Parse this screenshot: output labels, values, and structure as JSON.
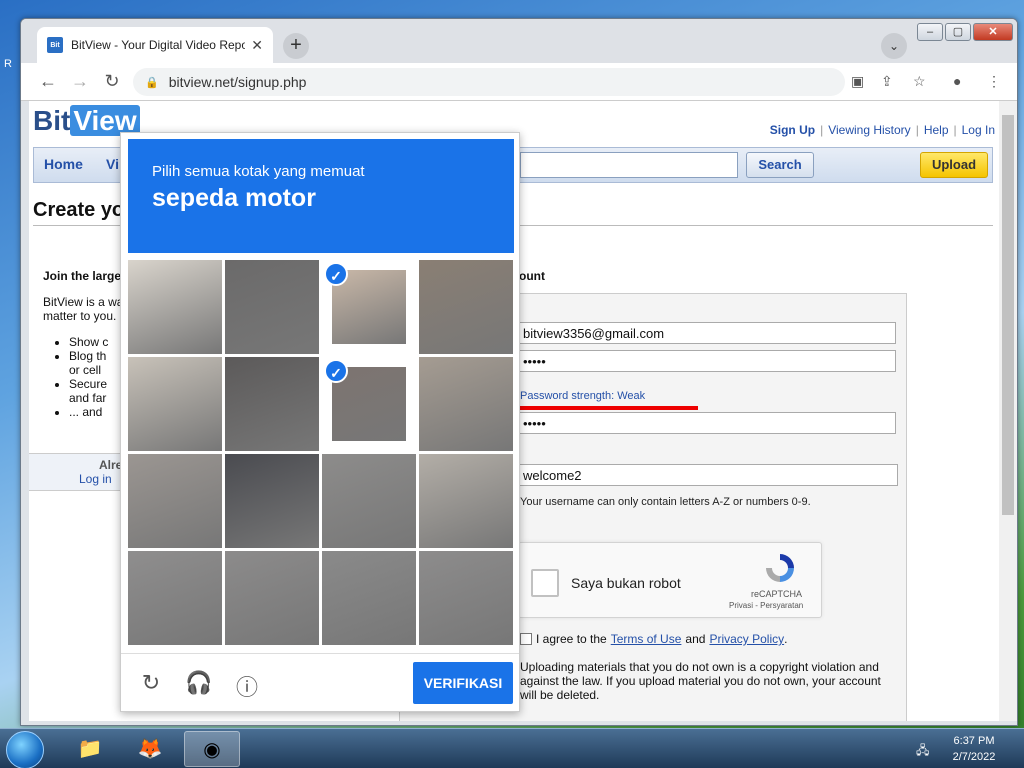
{
  "desktop": {
    "corner_text": "R"
  },
  "browser": {
    "tab_favicon": "Bit",
    "tab_title": "BitView - Your Digital Video Repo",
    "url": "bitview.net/signup.php",
    "icons": [
      "back-icon",
      "forward-icon",
      "reload-icon",
      "lock-icon",
      "cast-icon",
      "share-icon",
      "star-icon",
      "profile-icon",
      "menu-icon"
    ]
  },
  "site": {
    "logo_a": "Bit",
    "logo_b": "View",
    "links": [
      "Sign Up",
      "Viewing History",
      "Help",
      "Log In"
    ],
    "nav_home": "Home",
    "nav_vi": "Vi",
    "search_label": "Search",
    "upload_label": "Upload",
    "page_heading": "Create yo",
    "join_heading": "Join the large",
    "intro_line1": "BitView is a wa",
    "intro_line2": "matter to you.",
    "bullets": [
      "Show c",
      "Blog th",
      "or cell",
      "Secure",
      "and far",
      "... and"
    ],
    "already_label": "Alrea",
    "login_link": "Log in",
    "account_heading": "ount",
    "email_value": "bitview3356@gmail.com",
    "password_value": "•••••",
    "password_strength": "Password strength: Weak",
    "confirm_value": "•••••",
    "username_value": "welcome2",
    "username_hint": "Your username can only contain letters A-Z or numbers 0-9.",
    "recaptcha_label": "Saya bukan robot",
    "recaptcha_brand": "reCAPTCHA",
    "recaptcha_links": "Privasi - Persyaratan",
    "agree_prefix": "I agree to the",
    "terms_link": "Terms of Use",
    "agree_and": "and",
    "privacy_link": "Privacy Policy",
    "agree_suffix": ".",
    "warning_text": "Uploading materials that you do not own is a copyright violation and against the law. If you upload material you do not own, your account will be deleted."
  },
  "captcha": {
    "instruction": "Pilih semua kotak yang memuat",
    "object": "sepeda motor",
    "verify_label": "VERIFIKASI",
    "selected_tiles": [
      2,
      6
    ],
    "footer_icons": [
      "reload-icon",
      "audio-icon",
      "info-icon"
    ]
  },
  "taskbar": {
    "time": "6:37 PM",
    "date": "2/7/2022",
    "apps": [
      "explorer-icon",
      "firefox-icon",
      "chrome-icon"
    ]
  },
  "colors": {
    "captcha_blue": "#1a73e8",
    "link_blue": "#2450a8",
    "strength_bar": "#e00000"
  }
}
